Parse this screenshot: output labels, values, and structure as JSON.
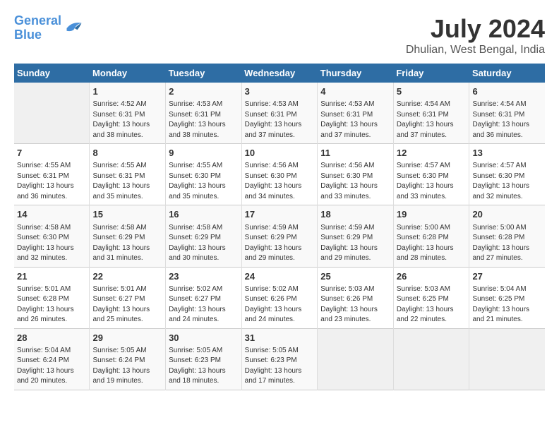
{
  "logo": {
    "line1": "General",
    "line2": "Blue"
  },
  "title": "July 2024",
  "subtitle": "Dhulian, West Bengal, India",
  "days_header": [
    "Sunday",
    "Monday",
    "Tuesday",
    "Wednesday",
    "Thursday",
    "Friday",
    "Saturday"
  ],
  "weeks": [
    [
      {
        "day": "",
        "info": ""
      },
      {
        "day": "1",
        "info": "Sunrise: 4:52 AM\nSunset: 6:31 PM\nDaylight: 13 hours\nand 38 minutes."
      },
      {
        "day": "2",
        "info": "Sunrise: 4:53 AM\nSunset: 6:31 PM\nDaylight: 13 hours\nand 38 minutes."
      },
      {
        "day": "3",
        "info": "Sunrise: 4:53 AM\nSunset: 6:31 PM\nDaylight: 13 hours\nand 37 minutes."
      },
      {
        "day": "4",
        "info": "Sunrise: 4:53 AM\nSunset: 6:31 PM\nDaylight: 13 hours\nand 37 minutes."
      },
      {
        "day": "5",
        "info": "Sunrise: 4:54 AM\nSunset: 6:31 PM\nDaylight: 13 hours\nand 37 minutes."
      },
      {
        "day": "6",
        "info": "Sunrise: 4:54 AM\nSunset: 6:31 PM\nDaylight: 13 hours\nand 36 minutes."
      }
    ],
    [
      {
        "day": "7",
        "info": "Sunrise: 4:55 AM\nSunset: 6:31 PM\nDaylight: 13 hours\nand 36 minutes."
      },
      {
        "day": "8",
        "info": "Sunrise: 4:55 AM\nSunset: 6:31 PM\nDaylight: 13 hours\nand 35 minutes."
      },
      {
        "day": "9",
        "info": "Sunrise: 4:55 AM\nSunset: 6:30 PM\nDaylight: 13 hours\nand 35 minutes."
      },
      {
        "day": "10",
        "info": "Sunrise: 4:56 AM\nSunset: 6:30 PM\nDaylight: 13 hours\nand 34 minutes."
      },
      {
        "day": "11",
        "info": "Sunrise: 4:56 AM\nSunset: 6:30 PM\nDaylight: 13 hours\nand 33 minutes."
      },
      {
        "day": "12",
        "info": "Sunrise: 4:57 AM\nSunset: 6:30 PM\nDaylight: 13 hours\nand 33 minutes."
      },
      {
        "day": "13",
        "info": "Sunrise: 4:57 AM\nSunset: 6:30 PM\nDaylight: 13 hours\nand 32 minutes."
      }
    ],
    [
      {
        "day": "14",
        "info": "Sunrise: 4:58 AM\nSunset: 6:30 PM\nDaylight: 13 hours\nand 32 minutes."
      },
      {
        "day": "15",
        "info": "Sunrise: 4:58 AM\nSunset: 6:29 PM\nDaylight: 13 hours\nand 31 minutes."
      },
      {
        "day": "16",
        "info": "Sunrise: 4:58 AM\nSunset: 6:29 PM\nDaylight: 13 hours\nand 30 minutes."
      },
      {
        "day": "17",
        "info": "Sunrise: 4:59 AM\nSunset: 6:29 PM\nDaylight: 13 hours\nand 29 minutes."
      },
      {
        "day": "18",
        "info": "Sunrise: 4:59 AM\nSunset: 6:29 PM\nDaylight: 13 hours\nand 29 minutes."
      },
      {
        "day": "19",
        "info": "Sunrise: 5:00 AM\nSunset: 6:28 PM\nDaylight: 13 hours\nand 28 minutes."
      },
      {
        "day": "20",
        "info": "Sunrise: 5:00 AM\nSunset: 6:28 PM\nDaylight: 13 hours\nand 27 minutes."
      }
    ],
    [
      {
        "day": "21",
        "info": "Sunrise: 5:01 AM\nSunset: 6:28 PM\nDaylight: 13 hours\nand 26 minutes."
      },
      {
        "day": "22",
        "info": "Sunrise: 5:01 AM\nSunset: 6:27 PM\nDaylight: 13 hours\nand 25 minutes."
      },
      {
        "day": "23",
        "info": "Sunrise: 5:02 AM\nSunset: 6:27 PM\nDaylight: 13 hours\nand 24 minutes."
      },
      {
        "day": "24",
        "info": "Sunrise: 5:02 AM\nSunset: 6:26 PM\nDaylight: 13 hours\nand 24 minutes."
      },
      {
        "day": "25",
        "info": "Sunrise: 5:03 AM\nSunset: 6:26 PM\nDaylight: 13 hours\nand 23 minutes."
      },
      {
        "day": "26",
        "info": "Sunrise: 5:03 AM\nSunset: 6:25 PM\nDaylight: 13 hours\nand 22 minutes."
      },
      {
        "day": "27",
        "info": "Sunrise: 5:04 AM\nSunset: 6:25 PM\nDaylight: 13 hours\nand 21 minutes."
      }
    ],
    [
      {
        "day": "28",
        "info": "Sunrise: 5:04 AM\nSunset: 6:24 PM\nDaylight: 13 hours\nand 20 minutes."
      },
      {
        "day": "29",
        "info": "Sunrise: 5:05 AM\nSunset: 6:24 PM\nDaylight: 13 hours\nand 19 minutes."
      },
      {
        "day": "30",
        "info": "Sunrise: 5:05 AM\nSunset: 6:23 PM\nDaylight: 13 hours\nand 18 minutes."
      },
      {
        "day": "31",
        "info": "Sunrise: 5:05 AM\nSunset: 6:23 PM\nDaylight: 13 hours\nand 17 minutes."
      },
      {
        "day": "",
        "info": ""
      },
      {
        "day": "",
        "info": ""
      },
      {
        "day": "",
        "info": ""
      }
    ]
  ]
}
